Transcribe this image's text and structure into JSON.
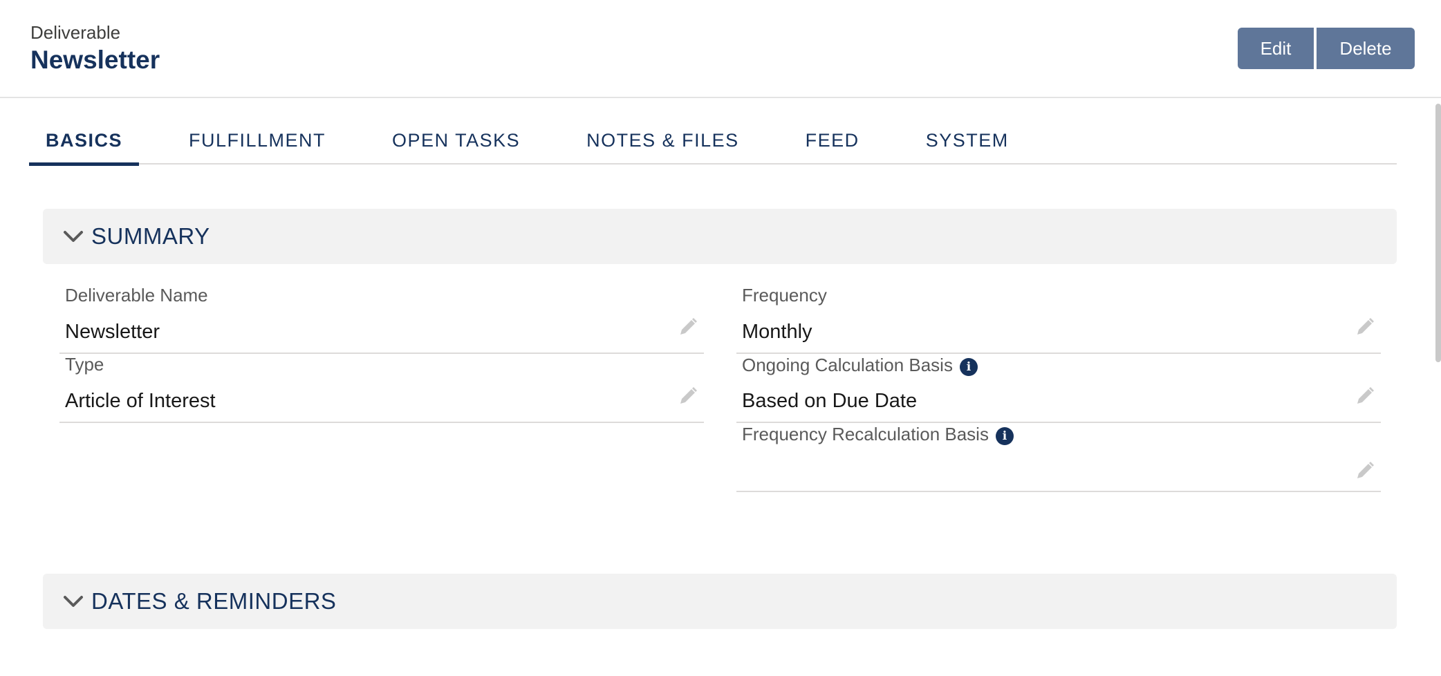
{
  "header": {
    "object_type": "Deliverable",
    "record_title": "Newsletter",
    "edit_label": "Edit",
    "delete_label": "Delete"
  },
  "tabs": [
    {
      "label": "BASICS",
      "active": true
    },
    {
      "label": "FULFILLMENT",
      "active": false
    },
    {
      "label": "OPEN TASKS",
      "active": false
    },
    {
      "label": "NOTES & FILES",
      "active": false
    },
    {
      "label": "FEED",
      "active": false
    },
    {
      "label": "SYSTEM",
      "active": false
    }
  ],
  "summary": {
    "title": "SUMMARY",
    "fields": {
      "deliverable_name": {
        "label": "Deliverable Name",
        "value": "Newsletter"
      },
      "type": {
        "label": "Type",
        "value": "Article of Interest"
      },
      "frequency": {
        "label": "Frequency",
        "value": "Monthly"
      },
      "ongoing_calc_basis": {
        "label": "Ongoing Calculation Basis",
        "value": "Based on Due Date"
      },
      "freq_recalc_basis": {
        "label": "Frequency Recalculation Basis",
        "value": ""
      }
    }
  },
  "dates_reminders": {
    "title": "DATES & REMINDERS"
  },
  "colors": {
    "brand_navy": "#16325c",
    "button_bg": "#5f7699",
    "section_bg": "#f2f2f2"
  },
  "icons": {
    "chevron": "chevron-down-icon",
    "edit": "pencil-icon",
    "info": "info-icon"
  }
}
